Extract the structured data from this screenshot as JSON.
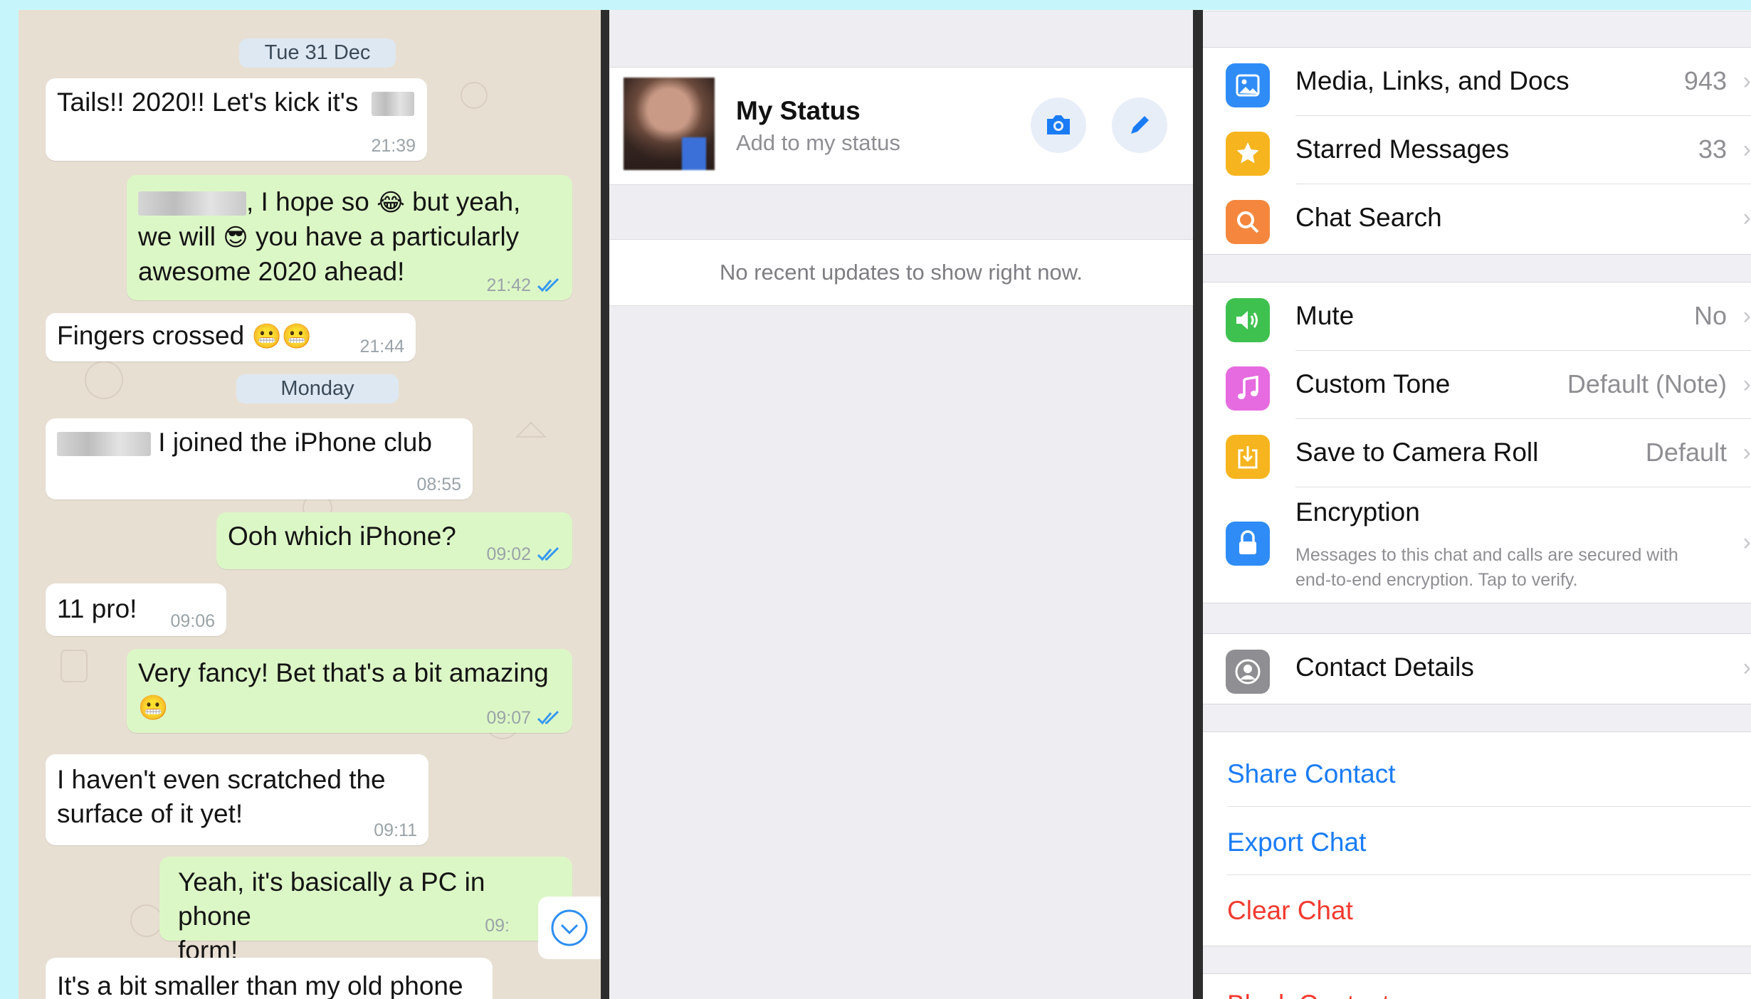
{
  "chat": {
    "date_1": "Tue 31 Dec",
    "date_2": "Monday",
    "messages": [
      {
        "dir": "in",
        "text": "Tails!! 2020!! Let's kick it's",
        "time": "21:39"
      },
      {
        "dir": "out",
        "text_a": ", I hope so",
        "text_b": "but yeah,",
        "text_c": "we will",
        "text_d": "you have a particularly",
        "text_e": "awesome 2020 ahead!",
        "time": "21:42"
      },
      {
        "dir": "in",
        "text": "Fingers crossed",
        "time": "21:44"
      },
      {
        "dir": "in",
        "text": "I joined the iPhone club",
        "time": "08:55"
      },
      {
        "dir": "out",
        "text": "Ooh which iPhone?",
        "time": "09:02"
      },
      {
        "dir": "in",
        "text": "11 pro!",
        "time": "09:06"
      },
      {
        "dir": "out",
        "text": "Very fancy! Bet that's a bit amazing",
        "time": "09:07"
      },
      {
        "dir": "in",
        "text_a": "I haven't even scratched the",
        "text_b": "surface of it yet!",
        "time": "09:11"
      },
      {
        "dir": "out",
        "text_a": "Yeah, it's basically a PC in phone",
        "text_b": "form!",
        "time": "09:"
      },
      {
        "dir": "in",
        "text": "It's a bit smaller than my old phone"
      }
    ],
    "emoji": {
      "laugh": "😂",
      "cool": "😎",
      "grin": "😬"
    }
  },
  "status": {
    "name": "My Status",
    "subtitle": "Add to my status",
    "empty": "No recent updates to show right now."
  },
  "settings": {
    "rows": [
      {
        "label": "Media, Links, and Docs",
        "value": "943",
        "icon": "photo-icon",
        "color": "#2f8cf6"
      },
      {
        "label": "Starred Messages",
        "value": "33",
        "icon": "star-icon",
        "color": "#f6b51e"
      },
      {
        "label": "Chat Search",
        "value": "",
        "icon": "search-icon",
        "color": "#f4873d"
      },
      {
        "label": "Mute",
        "value": "No",
        "icon": "speaker-icon",
        "color": "#3ec14f"
      },
      {
        "label": "Custom Tone",
        "value": "Default (Note)",
        "icon": "music-icon",
        "color": "#e66be0"
      },
      {
        "label": "Save to Camera Roll",
        "value": "Default",
        "icon": "download-icon",
        "color": "#f6b51e"
      },
      {
        "label": "Encryption",
        "value": "",
        "icon": "lock-icon",
        "color": "#2f8cf6"
      },
      {
        "label": "Contact Details",
        "value": "",
        "icon": "person-icon",
        "color": "#8e8e93"
      }
    ],
    "encryption_sub_1": "Messages to this chat and calls are secured with",
    "encryption_sub_2": "end-to-end encryption. Tap to verify.",
    "actions": {
      "share": "Share Contact",
      "export": "Export Chat",
      "clear": "Clear Chat",
      "block": "Block Contact"
    },
    "colors": {
      "link": "#1a7cf5",
      "danger": "#f23a30"
    }
  }
}
